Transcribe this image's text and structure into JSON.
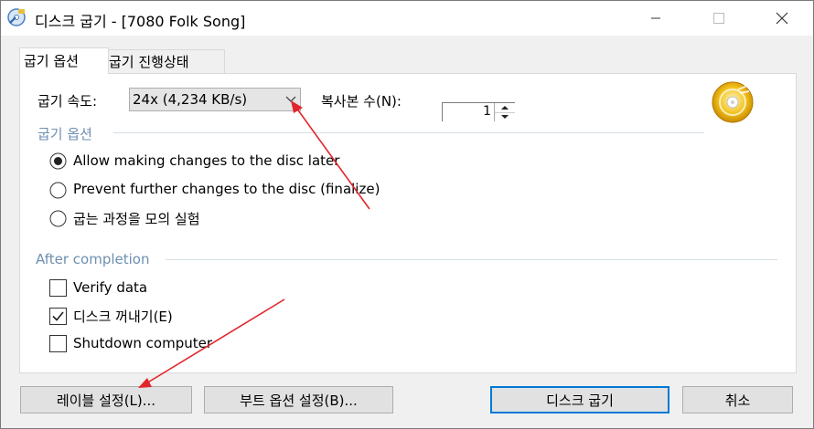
{
  "window": {
    "title": "디스크 굽기 - [7080 Folk Song]",
    "app_icon": "disc-burn-icon",
    "controls": [
      "minimize-icon",
      "maximize-icon",
      "close-icon"
    ]
  },
  "tabs": [
    {
      "label": "굽기 옵션",
      "active": true
    },
    {
      "label": "굽기 진행상태",
      "active": false
    }
  ],
  "burn": {
    "speed_label": "굽기 속도:",
    "speed_value": "24x (4,234 KB/s)",
    "copies_label": "복사본 수(N):",
    "copies_value": "1"
  },
  "burn_options": {
    "title": "굽기 옵션",
    "options": [
      {
        "label": "Allow making changes to the disc later",
        "selected": true
      },
      {
        "label": "Prevent further changes to the disc (finalize)",
        "selected": false
      },
      {
        "label": "굽는 과정을 모의 실험",
        "selected": false
      }
    ]
  },
  "after_completion": {
    "title": "After completion",
    "checks": [
      {
        "label": "Verify data",
        "checked": false
      },
      {
        "label": "디스크 꺼내기(E)",
        "checked": true
      },
      {
        "label": "Shutdown computer",
        "checked": false
      }
    ]
  },
  "buttons": {
    "label_settings": "레이블 설정(L)...",
    "boot_settings": "부트 옵션 설정(B)...",
    "burn_disc": "디스크 굽기",
    "cancel": "취소"
  },
  "colors": {
    "accent": "#0078d7",
    "group_title": "#6e8fb0",
    "annotation_arrow": "#e0262b"
  }
}
